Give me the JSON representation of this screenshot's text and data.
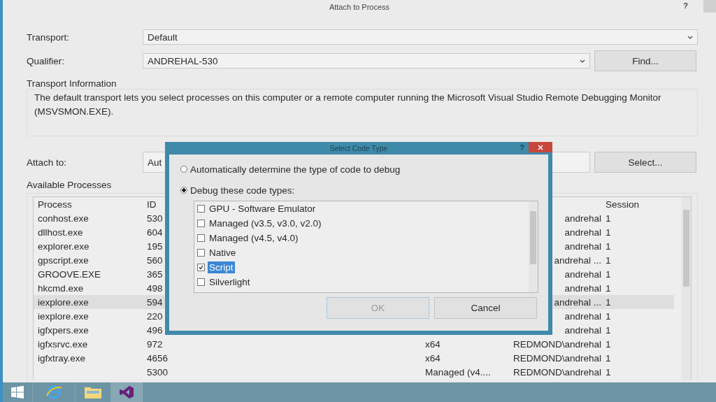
{
  "window": {
    "title": "Attach to Process",
    "help": "?"
  },
  "transport": {
    "label": "Transport:",
    "value": "Default"
  },
  "qualifier": {
    "label": "Qualifier:",
    "value": "ANDREHAL-530",
    "button": "Find..."
  },
  "transport_information": {
    "heading": "Transport Information",
    "text": "The default transport lets you select processes on this computer or a remote computer running the Microsoft Visual Studio Remote Debugging Monitor (MSVSMON.EXE)."
  },
  "attach_to": {
    "label": "Attach to:",
    "value": "Aut",
    "button": "Select..."
  },
  "available_processes": {
    "heading": "Available Processes",
    "columns": {
      "process": "Process",
      "id": "ID",
      "session": "Session"
    },
    "rows": [
      {
        "process": "conhost.exe",
        "id": "530",
        "user": "andrehal",
        "session": "1",
        "selected": false
      },
      {
        "process": "dllhost.exe",
        "id": "604",
        "user": "andrehal",
        "session": "1",
        "selected": false
      },
      {
        "process": "explorer.exe",
        "id": "195",
        "user": "andrehal",
        "session": "1",
        "selected": false
      },
      {
        "process": "gpscript.exe",
        "id": "560",
        "user": "andrehal ...",
        "session": "1",
        "selected": false
      },
      {
        "process": "GROOVE.EXE",
        "id": "365",
        "user": "andrehal",
        "session": "1",
        "selected": false
      },
      {
        "process": "hkcmd.exe",
        "id": "498",
        "user": "andrehal",
        "session": "1",
        "selected": false
      },
      {
        "process": "iexplore.exe",
        "id": "594",
        "user": "andrehal ...",
        "session": "1",
        "selected": true
      },
      {
        "process": "iexplore.exe",
        "id": "220",
        "user": "andrehal",
        "session": "1",
        "selected": false
      },
      {
        "process": "igfxpers.exe",
        "id": "496",
        "user": "andrehal",
        "session": "1",
        "selected": false
      },
      {
        "process": "igfxsrvc.exe",
        "id": "972",
        "type": "x64",
        "user": "REDMOND\\andrehal",
        "session": "1",
        "selected": false
      },
      {
        "process": "igfxtray.exe",
        "id": "4656",
        "type": "x64",
        "user": "REDMOND\\andrehal",
        "session": "1",
        "selected": false
      },
      {
        "id": "5300",
        "type": "Managed (v4....",
        "user": "REDMOND\\andrehal",
        "session": "1",
        "selected": false
      }
    ]
  },
  "dialog": {
    "title": "Select Code Type",
    "help": "?",
    "options": [
      {
        "label": "Automatically determine the type of code to debug",
        "selected": false
      },
      {
        "label": "Debug these code types:",
        "selected": true
      }
    ],
    "code_types": [
      {
        "label": "GPU - Software Emulator",
        "checked": false,
        "selected": false
      },
      {
        "label": "Managed (v3.5, v3.0, v2.0)",
        "checked": false,
        "selected": false
      },
      {
        "label": "Managed (v4.5, v4.0)",
        "checked": false,
        "selected": false
      },
      {
        "label": "Native",
        "checked": false,
        "selected": false
      },
      {
        "label": "Script",
        "checked": true,
        "selected": true
      },
      {
        "label": "Silverlight",
        "checked": false,
        "selected": false
      }
    ],
    "buttons": [
      {
        "label": "OK",
        "disabled": true
      },
      {
        "label": "Cancel",
        "disabled": false
      }
    ]
  }
}
